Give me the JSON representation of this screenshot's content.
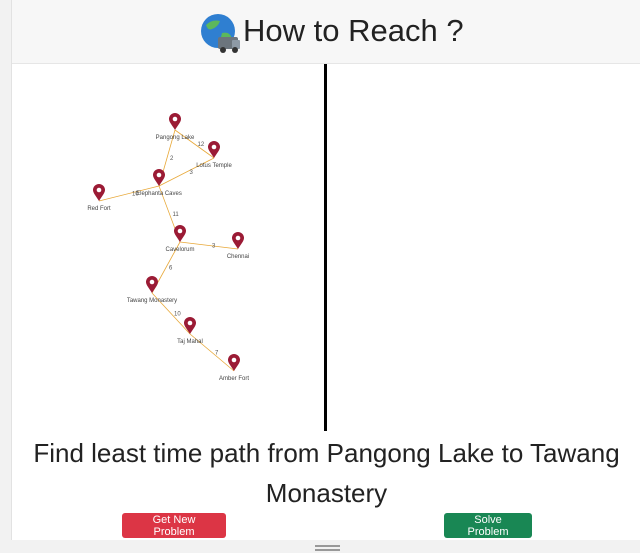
{
  "header": {
    "title": "How to Reach ?"
  },
  "problem": {
    "text": "Find least time path from Pangong Lake to Tawang Monastery"
  },
  "buttons": {
    "new_problem": "Get New Problem",
    "solve": "Solve Problem"
  },
  "graph": {
    "nodes": [
      {
        "id": "pangong",
        "label": "Pangong Lake"
      },
      {
        "id": "lotus",
        "label": "Lotus Temple"
      },
      {
        "id": "elephanta",
        "label": "Elephanta Caves"
      },
      {
        "id": "red",
        "label": "Red Fort"
      },
      {
        "id": "cavelorum",
        "label": "Cavelorum"
      },
      {
        "id": "chennai",
        "label": "Chennai"
      },
      {
        "id": "tawang",
        "label": "Tawang Monastery"
      },
      {
        "id": "tajmahal",
        "label": "Taj Mahal"
      },
      {
        "id": "amber",
        "label": "Amber Fort"
      }
    ],
    "edges": [
      {
        "from": "pangong",
        "to": "lotus",
        "weight": "12"
      },
      {
        "from": "pangong",
        "to": "elephanta",
        "weight": "2"
      },
      {
        "from": "lotus",
        "to": "elephanta",
        "weight": "3"
      },
      {
        "from": "elephanta",
        "to": "red",
        "weight": "10"
      },
      {
        "from": "elephanta",
        "to": "cavelorum",
        "weight": "11"
      },
      {
        "from": "cavelorum",
        "to": "chennai",
        "weight": "3"
      },
      {
        "from": "cavelorum",
        "to": "tawang",
        "weight": "6"
      },
      {
        "from": "tawang",
        "to": "tajmahal",
        "weight": "10"
      },
      {
        "from": "tajmahal",
        "to": "amber",
        "weight": "7"
      }
    ]
  },
  "colors": {
    "marker": "#9b1b35",
    "edge": "#e8a838",
    "danger": "#dc3545",
    "success": "#198754"
  }
}
